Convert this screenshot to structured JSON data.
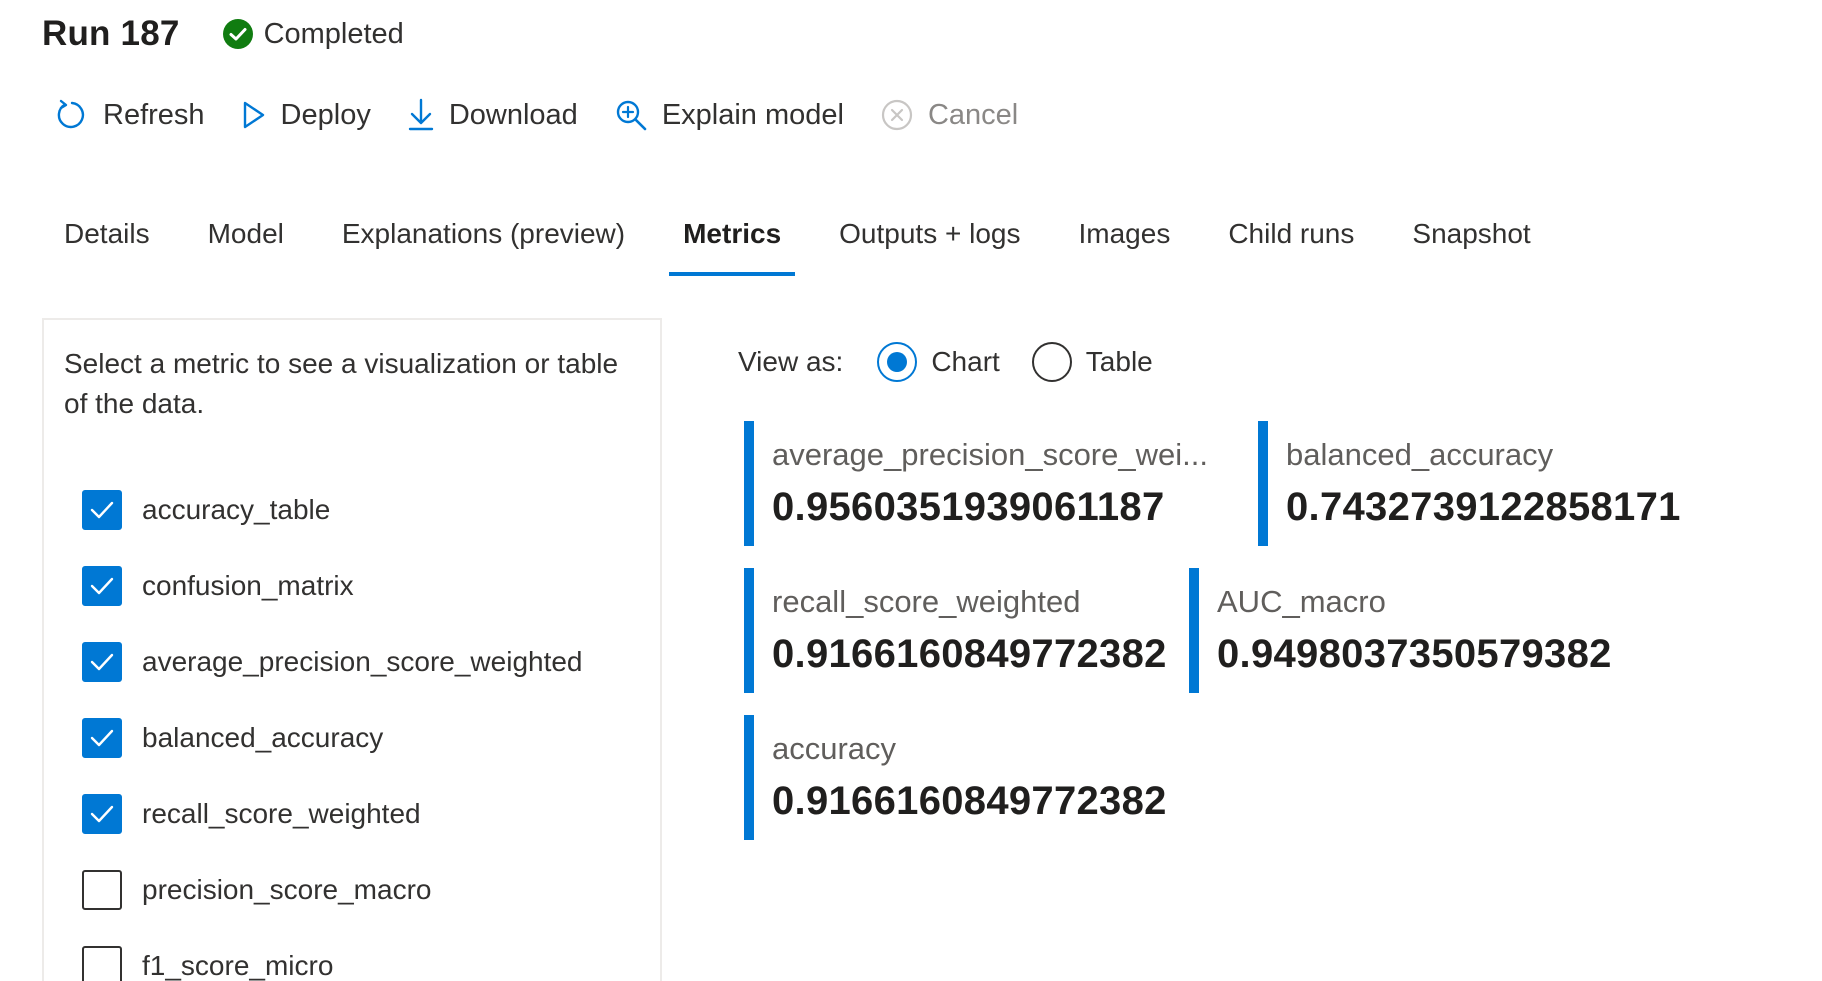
{
  "header": {
    "title": "Run 187",
    "status": "Completed",
    "status_color": "#107c10"
  },
  "toolbar": {
    "refresh": "Refresh",
    "deploy": "Deploy",
    "download": "Download",
    "explain": "Explain model",
    "cancel": "Cancel"
  },
  "tabs": [
    {
      "label": "Details"
    },
    {
      "label": "Model"
    },
    {
      "label": "Explanations (preview)"
    },
    {
      "label": "Metrics",
      "active": true
    },
    {
      "label": "Outputs + logs"
    },
    {
      "label": "Images"
    },
    {
      "label": "Child runs"
    },
    {
      "label": "Snapshot"
    }
  ],
  "left_panel": {
    "instructions": "Select a metric to see a visualization or table of the data.",
    "metrics": [
      {
        "label": "accuracy_table",
        "checked": true
      },
      {
        "label": "confusion_matrix",
        "checked": true
      },
      {
        "label": "average_precision_score_weighted",
        "checked": true
      },
      {
        "label": "balanced_accuracy",
        "checked": true
      },
      {
        "label": "recall_score_weighted",
        "checked": true
      },
      {
        "label": "precision_score_macro",
        "checked": false
      },
      {
        "label": "f1_score_micro",
        "checked": false
      }
    ]
  },
  "view_as": {
    "label": "View as:",
    "options": [
      {
        "label": "Chart",
        "selected": true
      },
      {
        "label": "Table",
        "selected": false
      }
    ]
  },
  "cards": [
    {
      "name": "average_precision_score_wei...",
      "value": "0.9560351939061187"
    },
    {
      "name": "balanced_accuracy",
      "value": "0.7432739122858171"
    },
    {
      "name": "recall_score_weighted",
      "value": "0.9166160849772382"
    },
    {
      "name": "AUC_macro",
      "value": "0.9498037350579382"
    },
    {
      "name": "accuracy",
      "value": "0.9166160849772382"
    }
  ],
  "colors": {
    "accent": "#0078d4",
    "success": "#107c10"
  }
}
